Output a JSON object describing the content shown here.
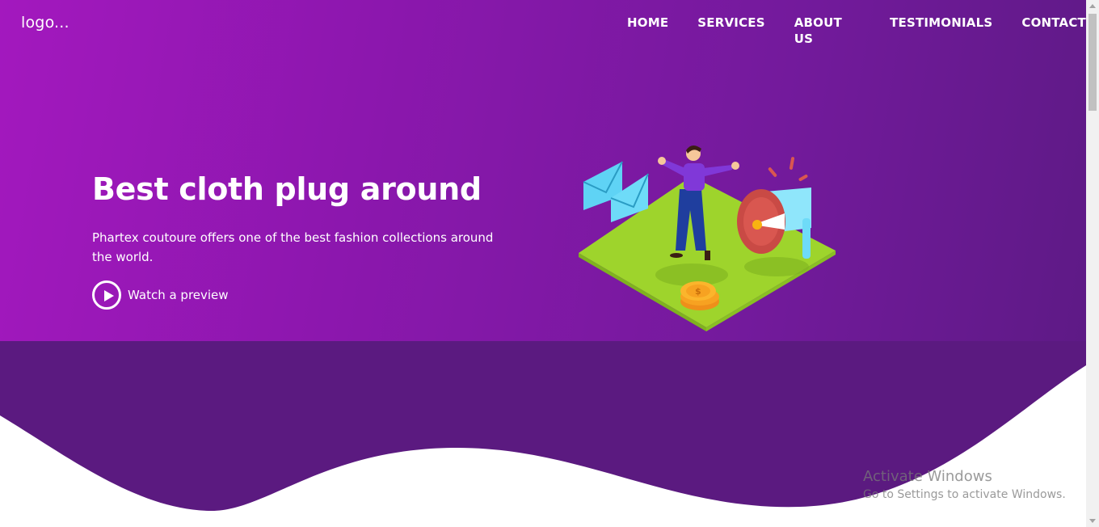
{
  "header": {
    "logo_text": "logo...",
    "nav": [
      {
        "label": "HOME"
      },
      {
        "label": "SERVICES"
      },
      {
        "label": "ABOUT US"
      },
      {
        "label": "TESTIMONIALS"
      },
      {
        "label": "CONTACT"
      }
    ]
  },
  "hero": {
    "headline": "Best cloth plug around",
    "subtext": "Phartex coutoure offers one of the best fashion collections around the world.",
    "preview_label": "Watch a preview",
    "illustration": "person-with-megaphone-and-envelopes"
  },
  "os_overlay": {
    "title": "Activate Windows",
    "subtitle": "Go to Settings to activate Windows."
  },
  "colors": {
    "hero_start": "#a318be",
    "hero_end": "#5e1a86",
    "wave": "#5b1a80",
    "platform": "#9ed42c"
  }
}
